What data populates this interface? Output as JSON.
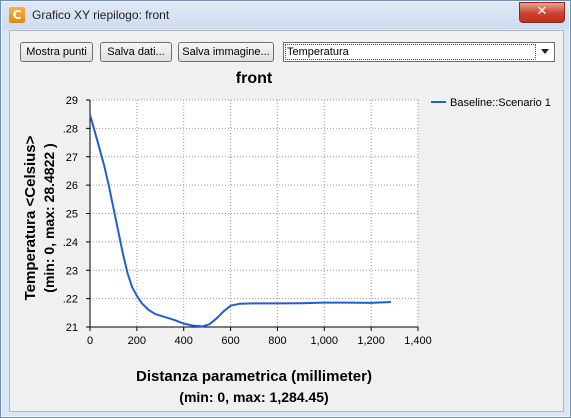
{
  "window": {
    "title": "Grafico XY riepilogo: front",
    "close_symbol": "✕",
    "app_icon_letter": "C",
    "app_icon_name": "app-icon"
  },
  "toolbar": {
    "show_points_label": "Mostra punti",
    "save_data_label": "Salva dati...",
    "save_image_label": "Salva immagine...",
    "variable_select_value": "Temperatura"
  },
  "chart_data": {
    "type": "line",
    "title": "front",
    "xlabel": "Distanza parametrica (millimeter)",
    "xlabel_line2": "(min: 0, max: 1,284.45)",
    "ylabel": "Temperatura <Celsius>",
    "ylabel_line2": "(min: 0, max: 28.4822 )",
    "xlim": [
      0,
      1400
    ],
    "ylim": [
      21,
      29
    ],
    "x_ticks": [
      0,
      200,
      400,
      600,
      800,
      1000,
      1200,
      1400
    ],
    "x_tick_labels": [
      "0",
      "200",
      "400",
      "600",
      "800",
      "1,000",
      "1,200",
      "1,400"
    ],
    "y_ticks": [
      21,
      22,
      23,
      24,
      25,
      26,
      27,
      28,
      29
    ],
    "y_tick_labels": [
      "21",
      ".22",
      "23",
      ".24",
      "25",
      "26",
      "27",
      ".28",
      "29"
    ],
    "grid": true,
    "legend_position": "right",
    "series": [
      {
        "name": "Baseline::Scenario 1",
        "color": "#1f5fcf",
        "x": [
          0,
          20,
          40,
          60,
          80,
          100,
          120,
          140,
          160,
          180,
          200,
          220,
          250,
          280,
          320,
          360,
          400,
          440,
          480,
          510,
          540,
          570,
          600,
          640,
          700,
          800,
          900,
          1000,
          1100,
          1200,
          1284.45
        ],
        "y": [
          28.48,
          27.9,
          27.3,
          26.7,
          26.0,
          25.2,
          24.4,
          23.6,
          22.9,
          22.4,
          22.1,
          21.85,
          21.6,
          21.45,
          21.35,
          21.25,
          21.12,
          21.05,
          21.02,
          21.1,
          21.3,
          21.55,
          21.75,
          21.82,
          21.83,
          21.83,
          21.84,
          21.86,
          21.86,
          21.85,
          21.88
        ]
      }
    ]
  }
}
